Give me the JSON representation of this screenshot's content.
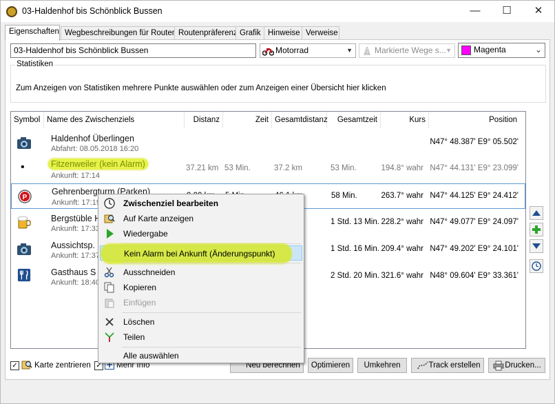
{
  "window": {
    "title": "03-Haldenhof bis Schönblick Bussen",
    "minimize": "—",
    "maximize": "☐",
    "close": "✕"
  },
  "tabs": [
    "Eigenschaften",
    "Wegbeschreibungen für Routen",
    "Routenpräferenz",
    "Grafik",
    "Hinweise",
    "Verweise"
  ],
  "props": {
    "route_name": "03-Haldenhof bis Schönblick Bussen",
    "vehicle": "Motorrad",
    "roads": "Markierte Wege s...",
    "color": "Magenta",
    "color_hex": "#ff00ff"
  },
  "stats": {
    "title": "Statistiken",
    "text": "Zum Anzeigen von Statistiken mehrere Punkte auswählen oder zum Anzeigen einer Übersicht hier klicken"
  },
  "list": {
    "headers": [
      "Symbol",
      "Name des Zwischenziels",
      "Distanz",
      "Zeit",
      "Gesamtdistanz",
      "Gesamtzeit",
      "Kurs",
      "Position"
    ],
    "rows": [
      {
        "icon": "camera-icon",
        "name": "Haldenhof Überlingen",
        "sub": "Abfahrt: 08.05.2018 16:20",
        "dist": "",
        "time": "",
        "total_dist": "",
        "total_time": "",
        "course": "",
        "pos": "N47° 48.387' E9° 05.502'"
      },
      {
        "icon": "dot-icon",
        "name": "Fitzenweiler (kein Alarm)",
        "sub": "Ankunft: 17:14",
        "dist": "37.21 km",
        "time": "53 Min.",
        "total_dist": "37.2 km",
        "total_time": "53 Min.",
        "course": "194.8° wahr",
        "pos": "N47° 44.131' E9° 23.099'"
      },
      {
        "icon": "parking-icon",
        "name": "Gehrenbergturm (Parken)",
        "sub": "Ankunft: 17:19",
        "dist": "9.00 km",
        "time": "5 Min.",
        "total_dist": "46.1 km",
        "total_time": "58 Min.",
        "course": "263.7° wahr",
        "pos": "N47° 44.125' E9° 24.412'"
      },
      {
        "icon": "beer-icon",
        "name": "Bergstüble H",
        "sub": "Ankunft: 17:33",
        "dist": "",
        "time": "",
        "total_dist": "",
        "total_time": "1 Std. 13 Min.",
        "course": "228.2° wahr",
        "pos": "N47° 49.077' E9° 24.097'"
      },
      {
        "icon": "camera-icon",
        "name": "Aussichtsp.",
        "sub": "Ankunft: 17:37",
        "dist": "",
        "time": "",
        "total_dist": "",
        "total_time": "1 Std. 16 Min.",
        "course": "209.4° wahr",
        "pos": "N47° 49.202' E9° 24.101'"
      },
      {
        "icon": "restaurant-icon",
        "name": "Gasthaus S",
        "sub": "Ankunft: 18:40",
        "dist": "",
        "time": "",
        "total_dist": "",
        "total_time": "2 Std. 20 Min.",
        "course": "321.6° wahr",
        "pos": "N48° 09.604' E9° 33.361'"
      }
    ]
  },
  "context_menu": [
    {
      "label": "Zwischenziel bearbeiten",
      "icon": "clock-icon"
    },
    {
      "label": "Auf Karte anzeigen",
      "icon": "map-search-icon"
    },
    {
      "label": "Wiedergabe",
      "icon": "play-icon"
    },
    {
      "label": "Kein Alarm bei Ankunft (Änderungspunkt)",
      "icon": ""
    },
    {
      "label": "Ausschneiden",
      "icon": "scissors-icon"
    },
    {
      "label": "Kopieren",
      "icon": "copy-icon"
    },
    {
      "label": "Einfügen",
      "icon": "paste-icon"
    },
    {
      "label": "Löschen",
      "icon": "delete-icon"
    },
    {
      "label": "Teilen",
      "icon": "split-icon"
    },
    {
      "label": "Alle auswählen",
      "icon": ""
    }
  ],
  "bottom": {
    "center_map": "Karte zentrieren",
    "more_info": "Mehr Info",
    "recalc": "Neu berechnen",
    "optimize": "Optimieren",
    "reverse": "Umkehren",
    "create_track": "Track erstellen",
    "print": "Drucken..."
  }
}
